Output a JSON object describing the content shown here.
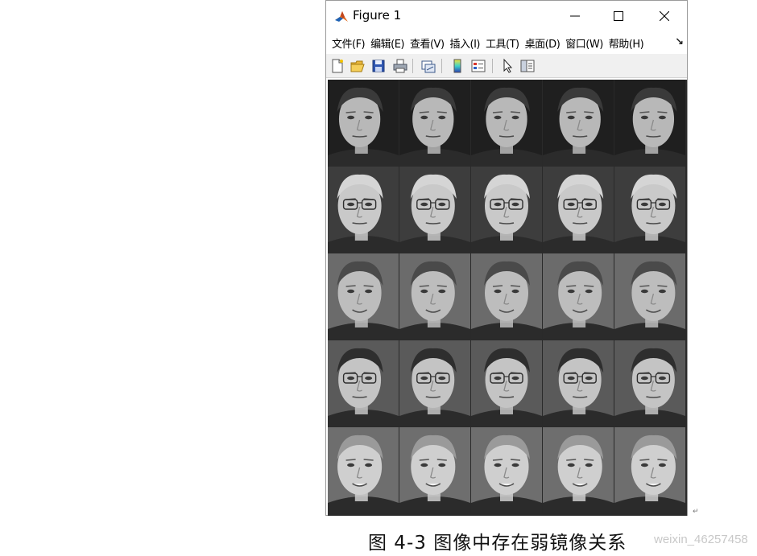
{
  "window": {
    "title": "Figure 1",
    "app_icon": "matlab-logo-icon",
    "controls": {
      "minimize": "minimize-icon",
      "maximize": "maximize-icon",
      "close": "close-icon"
    }
  },
  "menu": {
    "items": [
      "文件(F)",
      "编辑(E)",
      "查看(V)",
      "插入(I)",
      "工具(T)",
      "桌面(D)",
      "窗口(W)",
      "帮助(H)"
    ],
    "overflow_icon": "menu-overflow-icon"
  },
  "toolbar": {
    "buttons": [
      "new-figure-icon",
      "open-file-icon",
      "save-icon",
      "print-icon",
      "link-plot-icon",
      "colorbar-icon",
      "legend-icon",
      "pointer-icon",
      "property-editor-icon"
    ]
  },
  "figure": {
    "content": "face-image-grid",
    "rows": 5,
    "columns": 5
  },
  "caption": {
    "text": "图 4-3  图像中存在弱镜像关系"
  },
  "watermark": {
    "text": "weixin_46257458"
  },
  "colors": {
    "window_border": "#9a9a9a",
    "toolbar_bg": "#f0f0f0",
    "matlab_orange": "#e16b1e",
    "matlab_blue": "#1f63b5"
  }
}
